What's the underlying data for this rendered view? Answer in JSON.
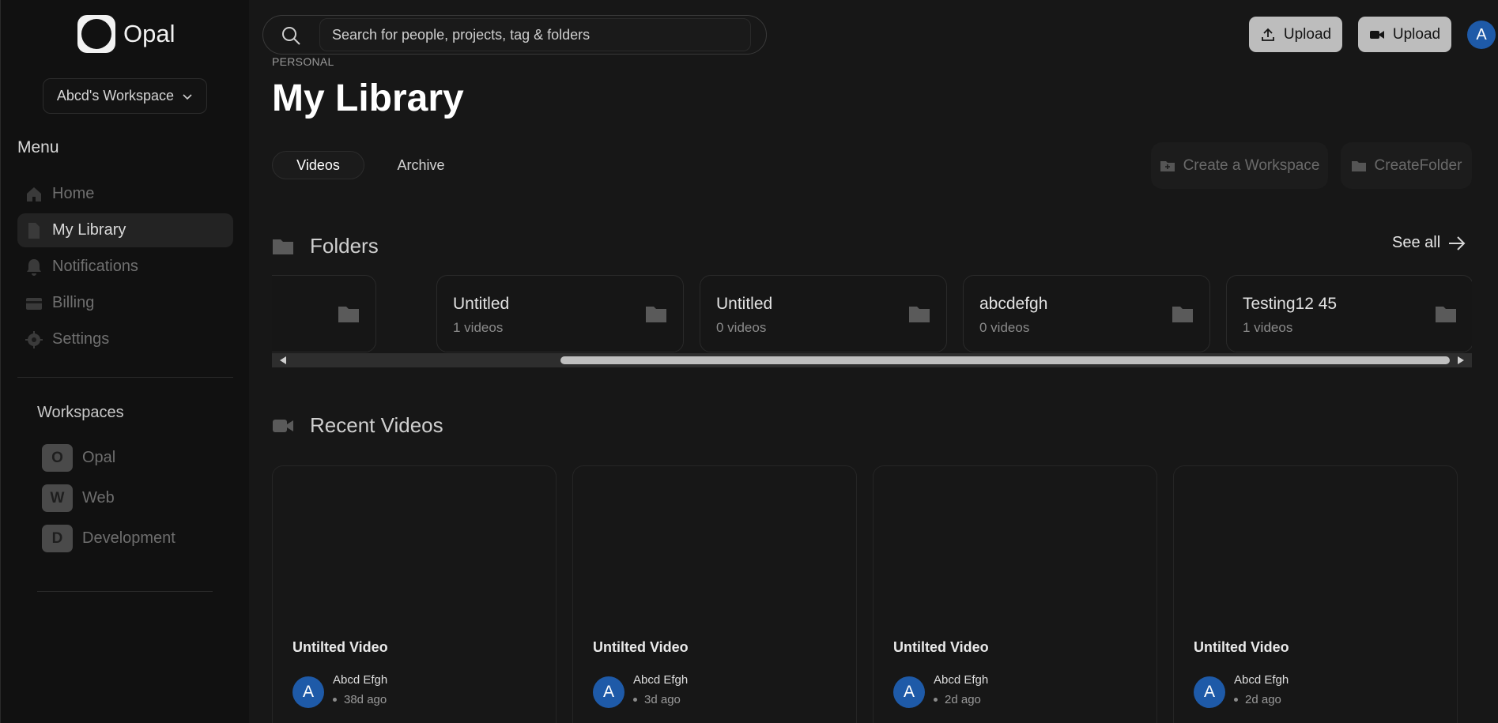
{
  "app": {
    "name": "Opal"
  },
  "workspace_selector": {
    "label": "Abcd's Workspace"
  },
  "menu": {
    "title": "Menu",
    "items": [
      {
        "label": "Home",
        "icon": "home-icon"
      },
      {
        "label": "My Library",
        "icon": "file-icon"
      },
      {
        "label": "Notifications",
        "icon": "bell-icon"
      },
      {
        "label": "Billing",
        "icon": "credit-card-icon"
      },
      {
        "label": "Settings",
        "icon": "gear-icon"
      }
    ]
  },
  "workspaces": {
    "title": "Workspaces",
    "items": [
      {
        "initial": "O",
        "label": "Opal"
      },
      {
        "initial": "W",
        "label": "Web"
      },
      {
        "initial": "D",
        "label": "Development"
      }
    ]
  },
  "search": {
    "placeholder": "Search for people, projects, tag & folders"
  },
  "header": {
    "upload_label": "Upload",
    "record_upload_label": "Upload",
    "avatar_initial": "A"
  },
  "page": {
    "breadcrumb": "PERSONAL",
    "title": "My Library",
    "tabs": [
      {
        "label": "Videos"
      },
      {
        "label": "Archive"
      }
    ],
    "create_workspace_label": "Create a Workspace",
    "create_folder_label": "CreateFolder"
  },
  "folders": {
    "title": "Folders",
    "see_all": "See all",
    "items": [
      {
        "name": "",
        "count": ""
      },
      {
        "name": "Untitled",
        "count": "1 videos"
      },
      {
        "name": "Untitled",
        "count": "0 videos"
      },
      {
        "name": "abcdefgh",
        "count": "0 videos"
      },
      {
        "name": "Testing12 45",
        "count": "1 videos"
      }
    ]
  },
  "recent_videos": {
    "title": "Recent Videos",
    "items": [
      {
        "title": "Untilted Video",
        "author": "Abcd Efgh",
        "avatar": "A",
        "time": "38d ago"
      },
      {
        "title": "Untilted Video",
        "author": "Abcd Efgh",
        "avatar": "A",
        "time": "3d ago"
      },
      {
        "title": "Untilted Video",
        "author": "Abcd Efgh",
        "avatar": "A",
        "time": "2d ago"
      },
      {
        "title": "Untilted Video",
        "author": "Abcd Efgh",
        "avatar": "A",
        "time": "2d ago"
      }
    ]
  },
  "colors": {
    "background": "#171717",
    "sidebar": "#111111",
    "accent_avatar": "#1e5aa8",
    "upload_button": "#bdbdbd"
  }
}
